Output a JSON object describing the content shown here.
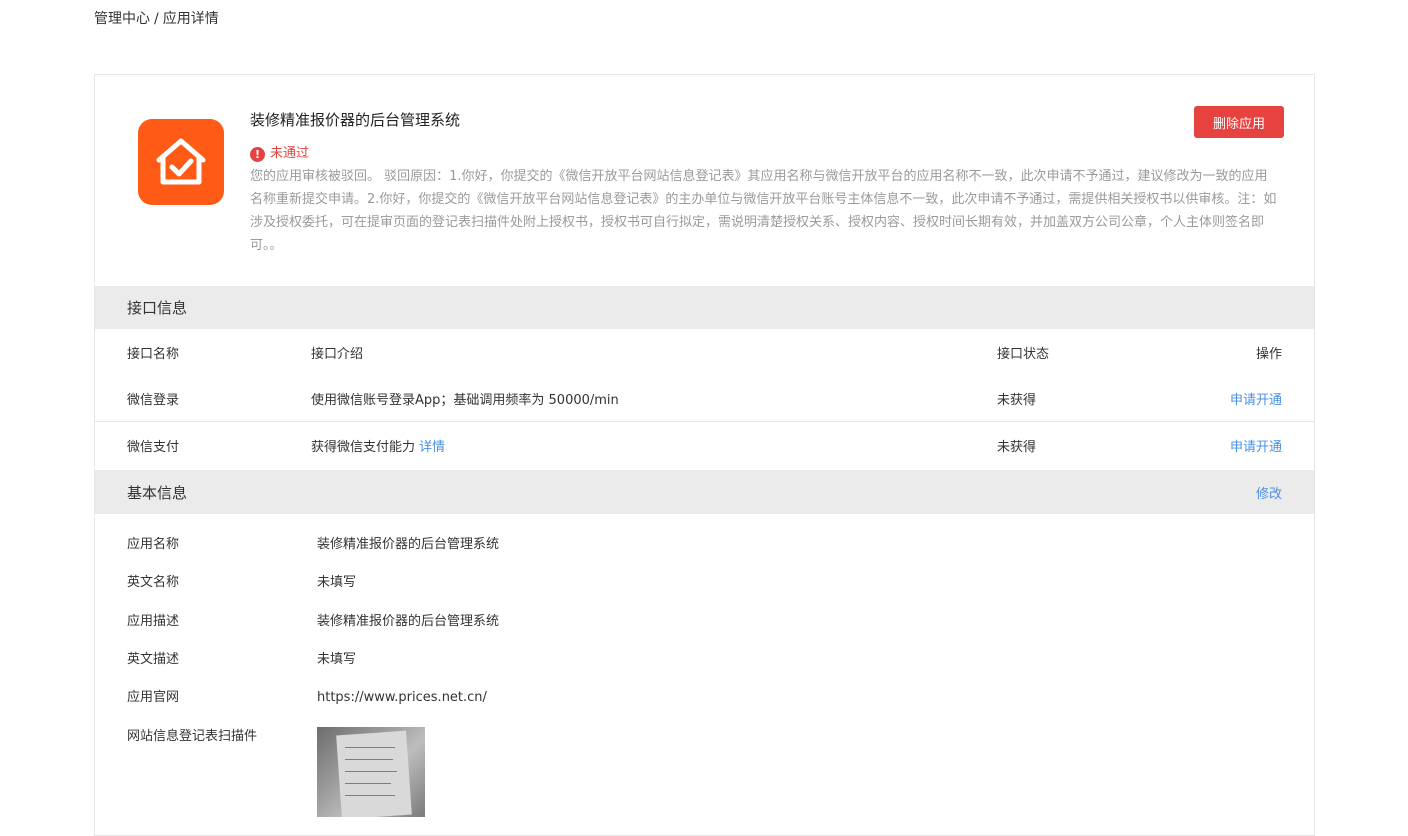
{
  "breadcrumb": {
    "root": "管理中心",
    "separator": "/",
    "current": "应用详情"
  },
  "app": {
    "title": "装修精准报价器的后台管理系统",
    "icon": "house-check-icon",
    "status_label": "未通过",
    "status_color": "#e64340",
    "reject_message": "您的应用审核被驳回。 驳回原因：1.你好，你提交的《微信开放平台网站信息登记表》其应用名称与微信开放平台的应用名称不一致，此次申请不予通过，建议修改为一致的应用名称重新提交申请。2.你好，你提交的《微信开放平台网站信息登记表》的主办单位与微信开放平台账号主体信息不一致，此次申请不予通过，需提供相关授权书以供审核。注：如涉及授权委托，可在提审页面的登记表扫描件处附上授权书，授权书可自行拟定，需说明清楚授权关系、授权内容、授权时间长期有效，并加盖双方公司公章，个人主体则签名即可。。",
    "delete_button": "删除应用"
  },
  "api_section": {
    "title": "接口信息",
    "columns": [
      "接口名称",
      "接口介绍",
      "接口状态",
      "操作"
    ],
    "rows": [
      {
        "name": "微信登录",
        "intro": "使用微信账号登录App；基础调用频率为 50000/min",
        "intro_link": "",
        "status": "未获得",
        "action": "申请开通"
      },
      {
        "name": "微信支付",
        "intro": "获得微信支付能力",
        "intro_link": "详情",
        "status": "未获得",
        "action": "申请开通"
      }
    ]
  },
  "basic_section": {
    "title": "基本信息",
    "edit_label": "修改",
    "fields": [
      {
        "label": "应用名称",
        "value": "装修精准报价器的后台管理系统"
      },
      {
        "label": "英文名称",
        "value": "未填写"
      },
      {
        "label": "应用描述",
        "value": "装修精准报价器的后台管理系统"
      },
      {
        "label": "英文描述",
        "value": "未填写"
      },
      {
        "label": "应用官网",
        "value": "https://www.prices.net.cn/"
      },
      {
        "label": "网站信息登记表扫描件",
        "value": ""
      }
    ]
  },
  "colors": {
    "accent_link": "#4a90e2",
    "danger": "#e64340",
    "app_icon_bg": "#ff5a16",
    "section_bg": "#ebebeb"
  }
}
